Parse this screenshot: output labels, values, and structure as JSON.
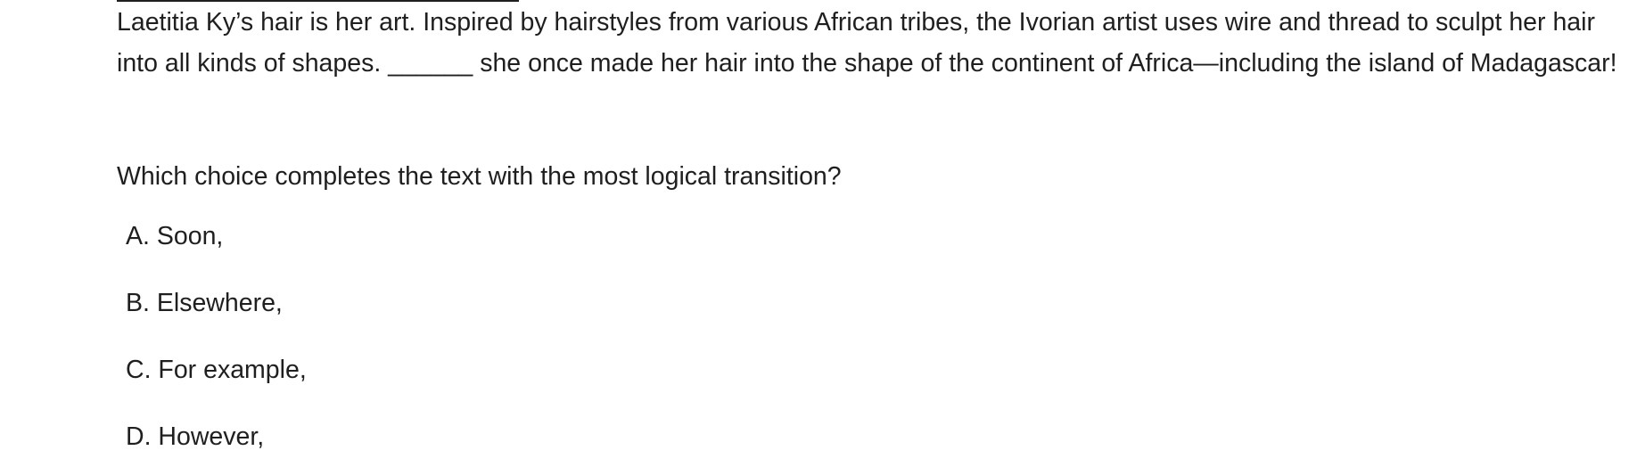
{
  "passage": "Laetitia Ky’s hair is her art. Inspired by hairstyles from various African tribes, the Ivorian artist uses wire and thread to sculpt her hair into all kinds of shapes. ______ she once made her hair into the shape of the continent of Africa—including the island of Madagascar!",
  "question": "Which choice completes the text with the most logical transition?",
  "choices": [
    {
      "letter": "A.",
      "text": "Soon,"
    },
    {
      "letter": "B.",
      "text": "Elsewhere,"
    },
    {
      "letter": "C.",
      "text": "For example,"
    },
    {
      "letter": "D.",
      "text": "However,"
    }
  ]
}
